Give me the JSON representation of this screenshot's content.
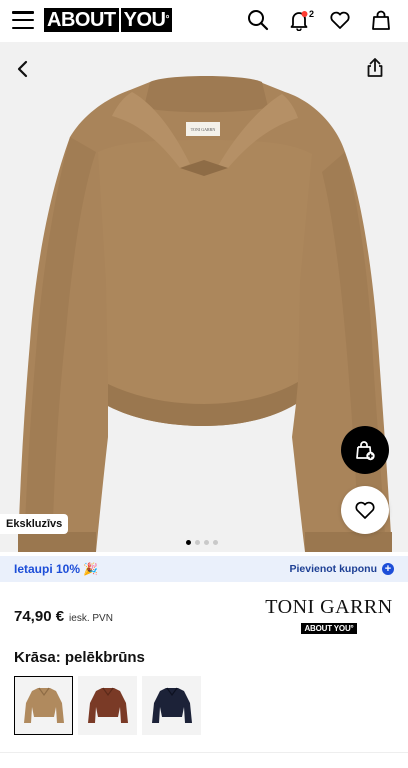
{
  "header": {
    "logo_left": "ABOUT",
    "logo_right": "YOU",
    "logo_mark": "°",
    "notification_count": "2",
    "icons": [
      "menu-icon",
      "search-icon",
      "bell-icon",
      "heart-icon",
      "bag-icon"
    ]
  },
  "gallery": {
    "exclusive_label": "Ekskluzīvs",
    "dots_total": 4,
    "active_dot": 1,
    "product_label": "TONI GARRN"
  },
  "coupon": {
    "left_text": "Ietaupi 10% 🎉",
    "right_text": "Pievienot kuponu"
  },
  "price": {
    "value": "74,90 €",
    "vat_note": "iesk. PVN"
  },
  "brand": {
    "name": "TONI GARRN",
    "sub_left": "ABOUT",
    "sub_right": "YOU°"
  },
  "color": {
    "label": "Krāsa: pelēkbrūns",
    "swatches": [
      {
        "name": "pelēkbrūns",
        "hex": "#b08a5e",
        "selected": true
      },
      {
        "name": "brown",
        "hex": "#7a3a26",
        "selected": false
      },
      {
        "name": "navy",
        "hex": "#1c2238",
        "selected": false
      }
    ]
  },
  "colors": {
    "coupon_bg": "#eaf0fb",
    "coupon_text": "#1d4ed8",
    "sweater": "#a9845a"
  }
}
